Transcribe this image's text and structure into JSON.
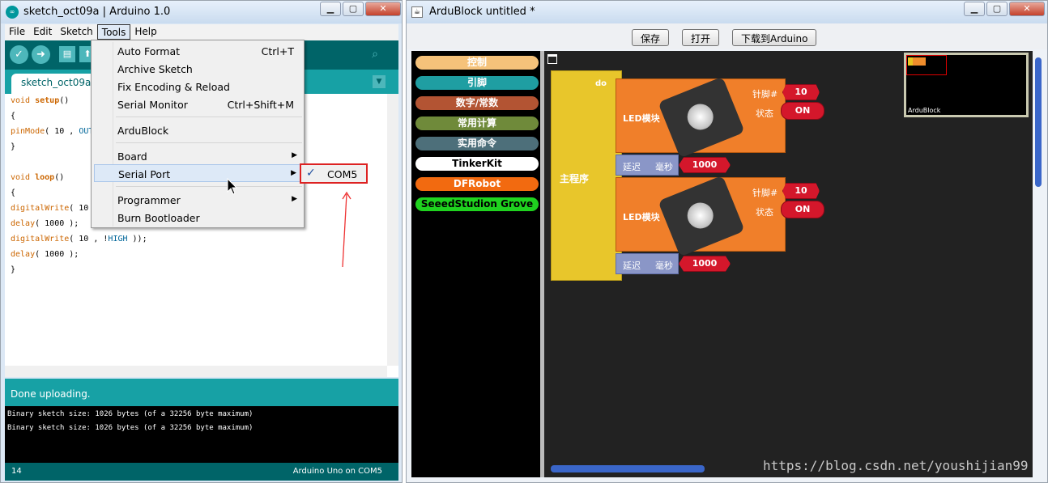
{
  "arduino": {
    "title": "sketch_oct09a | Arduino 1.0",
    "menu": [
      "File",
      "Edit",
      "Sketch",
      "Tools",
      "Help"
    ],
    "tab_name": "sketch_oct09a §",
    "code": {
      "l1a": "void",
      "l1b": "setup",
      "l1c": "()",
      "l2": "{",
      "l3a": "pinMode",
      "l3b": "( 10 , ",
      "l3c": "OUT",
      "l4": "}",
      "l5a": "void",
      "l5b": "loop",
      "l5c": "()",
      "l6": "{",
      "l7a": "digitalWrite",
      "l7b": "( 10",
      "l8a": "delay",
      "l8b": "( 1000 );",
      "l9a": "digitalWrite",
      "l9b": "( 10 , !",
      "l9c": "HIGH",
      "l9d": " ));",
      "l10a": "delay",
      "l10b": "( 1000 );",
      "l11": "}"
    },
    "status": "Done uploading.",
    "console": [
      "Binary sketch size: 1026 bytes (of a 32256 byte maximum)",
      "Binary sketch size: 1026 bytes (of a 32256 byte maximum)"
    ],
    "line_number": "14",
    "board": "Arduino Uno on COM5"
  },
  "tools_menu": {
    "auto_format": "Auto Format",
    "auto_format_sc": "Ctrl+T",
    "archive": "Archive Sketch",
    "fix_encoding": "Fix Encoding & Reload",
    "serial_monitor": "Serial Monitor",
    "serial_monitor_sc": "Ctrl+Shift+M",
    "ardublock": "ArduBlock",
    "board": "Board",
    "serial_port": "Serial Port",
    "programmer": "Programmer",
    "burn": "Burn Bootloader",
    "port_item": "COM5"
  },
  "ardublock": {
    "title": "ArduBlock untitled *",
    "buttons": {
      "save": "保存",
      "open": "打开",
      "upload": "下载到Arduino"
    },
    "categories": [
      "控制",
      "引脚",
      "数字/常数",
      "常用计算",
      "实用命令",
      "TinkerKit",
      "DFRobot",
      "SeeedStudion Grove"
    ],
    "category_colors": [
      "#f5c27a",
      "#1f9ea2",
      "#b35433",
      "#6f8a3a",
      "#4d6f7a",
      "#ffffff",
      "#f26a10",
      "#1fd21f"
    ],
    "main_label": "主程序",
    "do_label": "do",
    "led_label": "LED模块",
    "pin_label": "针脚#",
    "state_label": "状态",
    "pin_value": "10",
    "state_value": "ON",
    "delay_label": "延迟",
    "ms_label": "毫秒",
    "delay_value": "1000",
    "minimap_label": "ArduBlock"
  },
  "watermark": "https://blog.csdn.net/youshijian99"
}
